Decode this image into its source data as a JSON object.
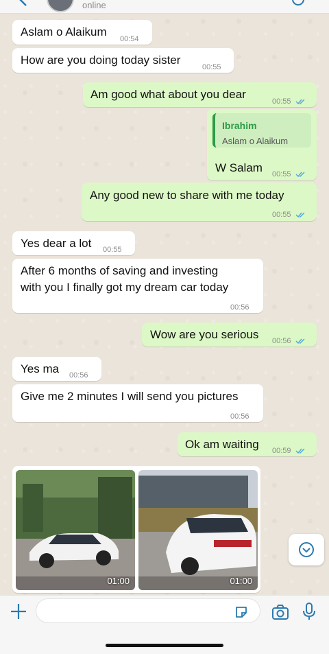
{
  "header": {
    "status": "online"
  },
  "messages": [
    {
      "dir": "in",
      "text": "Aslam o Alaikum",
      "time": "00:54"
    },
    {
      "dir": "in",
      "text": "How are you doing today sister",
      "time": "00:55"
    },
    {
      "dir": "out",
      "text": "Am good what about you dear",
      "time": "00:55"
    },
    {
      "dir": "out",
      "quote_name": "Ibrahim",
      "quote_text": "Aslam o Alaikum",
      "text": "W Salam",
      "time": "00:55"
    },
    {
      "dir": "out",
      "text": "Any good new to share with me today",
      "time": "00:55"
    },
    {
      "dir": "in",
      "text": "Yes dear a lot",
      "time": "00:55"
    },
    {
      "dir": "in",
      "line1": "After 6 months of saving and investing",
      "line2": "with you I finally got my dream car today",
      "time": "00:56"
    },
    {
      "dir": "out",
      "text": "Wow are you serious",
      "time": "00:56"
    },
    {
      "dir": "in",
      "text": "Yes ma",
      "time": "00:56"
    },
    {
      "dir": "in",
      "text": "Give me 2 minutes I will send you pictures",
      "time": "00:56"
    },
    {
      "dir": "out",
      "text": "Ok am waiting",
      "time": "00:59"
    }
  ],
  "media": [
    {
      "duration": "01:00",
      "icon": "video-thumbnail"
    },
    {
      "duration": "01:00",
      "icon": "video-thumbnail"
    }
  ],
  "icons": {
    "ticks": "read-receipt-double-check-icon",
    "scroll": "scroll-down-chevron-icon",
    "plus": "plus-icon",
    "sticker": "sticker-icon",
    "camera": "camera-icon",
    "mic": "microphone-icon"
  },
  "colors": {
    "incoming": "#ffffff",
    "outgoing": "#dcf8c6",
    "read_ticks": "#53a6d6",
    "quote_accent": "#2e9b47",
    "action_blue": "#2a7ab0"
  }
}
